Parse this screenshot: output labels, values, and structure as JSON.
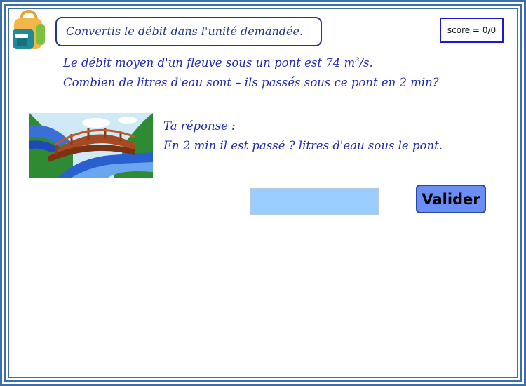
{
  "instruction": "Convertis le débit dans l'unité demandée.",
  "score": {
    "label": "score = ",
    "value": "0/0"
  },
  "question": {
    "line1_before": "Le débit moyen d'un fleuve sous un pont est 74 m",
    "line1_exponent": "3",
    "line1_after": "/s.",
    "line2": "Combien de litres d'eau sont – ils passés sous ce pont en 2 min?"
  },
  "response": {
    "label": "Ta réponse :",
    "statement": "En 2 min il est passé ? litres d'eau sous le pont."
  },
  "answer_input": {
    "value": ""
  },
  "validate_button": {
    "label": "Valider"
  },
  "colors": {
    "frame": "#3c6fa8",
    "text": "#1f2bb0",
    "input_bg": "#99ccff",
    "button_bg": "#6b8ef5"
  },
  "icons": {
    "logo": "backpack-icon",
    "illustration": "bridge-river-image"
  }
}
